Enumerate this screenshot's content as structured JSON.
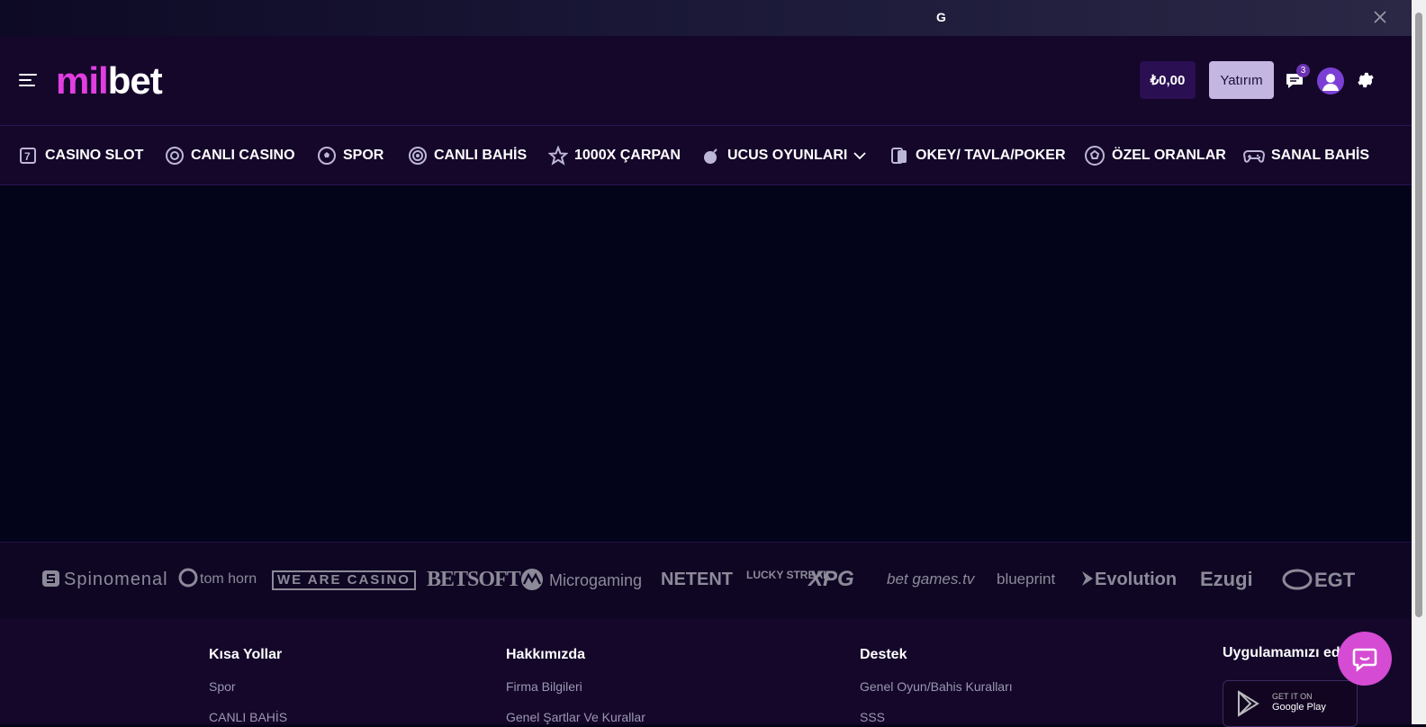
{
  "topbar": {
    "letter": "G"
  },
  "header": {
    "logo_part1": "mil",
    "logo_part2": "bet",
    "balance": "₺0,00",
    "deposit_label": "Yatırım",
    "notification_count": "3"
  },
  "nav": {
    "items": [
      {
        "label": "CASINO SLOT",
        "icon": "slot-machine-icon"
      },
      {
        "label": "CANLI CASINO",
        "icon": "roulette-chip-icon"
      },
      {
        "label": "SPOR",
        "icon": "football-icon"
      },
      {
        "label": "CANLI BAHİS",
        "icon": "live-broadcast-icon"
      },
      {
        "label": "1000X ÇARPAN",
        "icon": "star-icon"
      },
      {
        "label": "UCUS OYUNLARI",
        "icon": "bomb-icon"
      },
      {
        "label": "OKEY/ TAVLA/POKER",
        "icon": "playing-cards-icon"
      },
      {
        "label": "ÖZEL ORANLAR",
        "icon": "soccer-ball-icon"
      },
      {
        "label": "SANAL BAHİS",
        "icon": "gamepad-icon"
      }
    ]
  },
  "providers": [
    "Spinomenal",
    "tom horn",
    "WE ARE CASINO",
    "BETSOFT",
    "Microgaming",
    "NETENT",
    "LUCKY STREAK",
    "XPG",
    "bet games.tv",
    "blueprint",
    "Evolution",
    "Ezugi",
    "EGT"
  ],
  "footer": {
    "col1": {
      "title": "Kısa Yollar",
      "links": [
        "Spor",
        "CANLI BAHİS"
      ]
    },
    "col2": {
      "title": "Hakkımızda",
      "links": [
        "Firma Bilgileri",
        "Genel Şartlar Ve Kurallar"
      ]
    },
    "col3": {
      "title": "Destek",
      "links": [
        "Genel Oyun/Bahis Kuralları",
        "SSS"
      ]
    },
    "col4": {
      "title": "Uygulamamızı edi"
    },
    "googleplay": {
      "line1": "GET IT ON",
      "line2": "Google Play"
    }
  },
  "colors": {
    "brand": "#e13ee0",
    "header_bg": "#14072a",
    "page_bg": "#03031a",
    "deposit_bg": "#c3b7e2"
  }
}
